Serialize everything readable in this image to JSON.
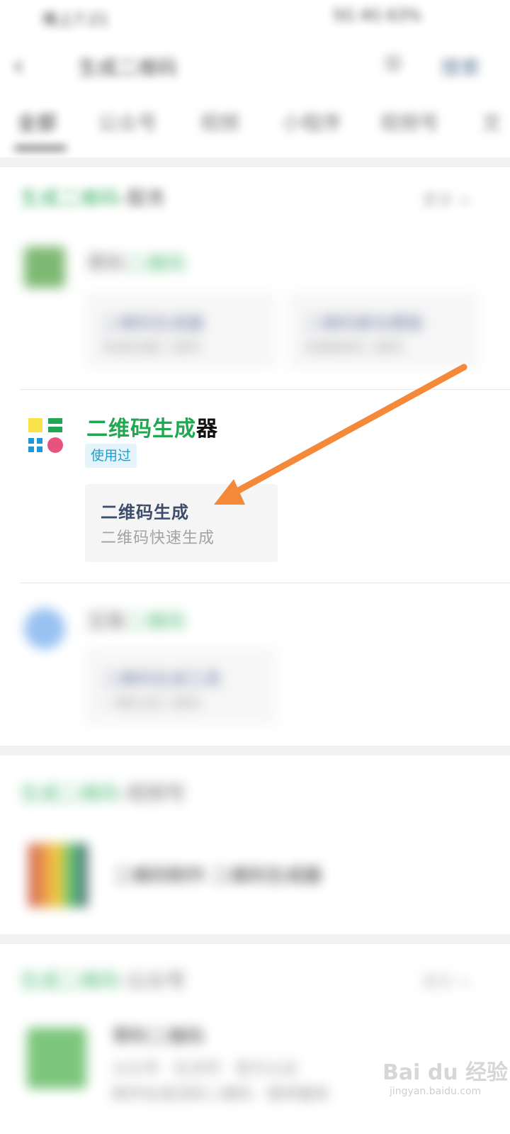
{
  "status_bar": {
    "left_text": "晚上7:21",
    "right_text": "5G 4G 63%"
  },
  "nav": {
    "back_icon": "chevron-left-icon",
    "query": "生成二维码",
    "clear_icon": "clear-icon",
    "search_label": "搜索"
  },
  "tabs": [
    {
      "label": "全部",
      "active": true
    },
    {
      "label": "公众号",
      "active": false
    },
    {
      "label": "视频",
      "active": false
    },
    {
      "label": "小程序",
      "active": false
    },
    {
      "label": "视频号",
      "active": false
    },
    {
      "label": "文",
      "active": false
    }
  ],
  "section_mini": {
    "title_highlight": "生成二维码",
    "title_rest": "-服务",
    "more": "更多 >"
  },
  "result_blurred_1": {
    "name_plain": "草料",
    "name_highlight": "二维码",
    "cards": [
      {
        "title": "二维码生成器",
        "desc": "快速创建二维码"
      },
      {
        "title": "二维码美化模板",
        "desc": "创建美观二维码"
      }
    ]
  },
  "result_focus": {
    "name_highlight": "二维码生成",
    "name_rest": "器",
    "badge": "使用过",
    "card": {
      "title": "二维码生成",
      "desc": "二维码快速生成"
    },
    "icon_colors": {
      "yellow": "#f7e24a",
      "green": "#1ea852",
      "blue": "#1f97d4",
      "pink": "#e8527c"
    }
  },
  "result_blurred_2": {
    "name_plain": "互联",
    "name_highlight": "二维码",
    "card": {
      "title": "二维码生成工具",
      "desc": "一键生成二维码"
    }
  },
  "section_channel": {
    "title_highlight": "生成二维码",
    "title_rest": "-视频号",
    "item": "二维码制作 二维码生成器"
  },
  "section_official": {
    "title_highlight": "生成二维码",
    "title_rest": "-公众号",
    "more": "更多 >",
    "item": "草料二维码",
    "line1": "公众号 · 生活号 · 官方认证",
    "line2": "制作生成活码二维码 · 提供服务"
  },
  "watermark": {
    "brand": "Bai du 经验",
    "url": "jingyan.baidu.com"
  },
  "colors": {
    "arrow": "#f5893a",
    "accent_green": "#20a851"
  }
}
